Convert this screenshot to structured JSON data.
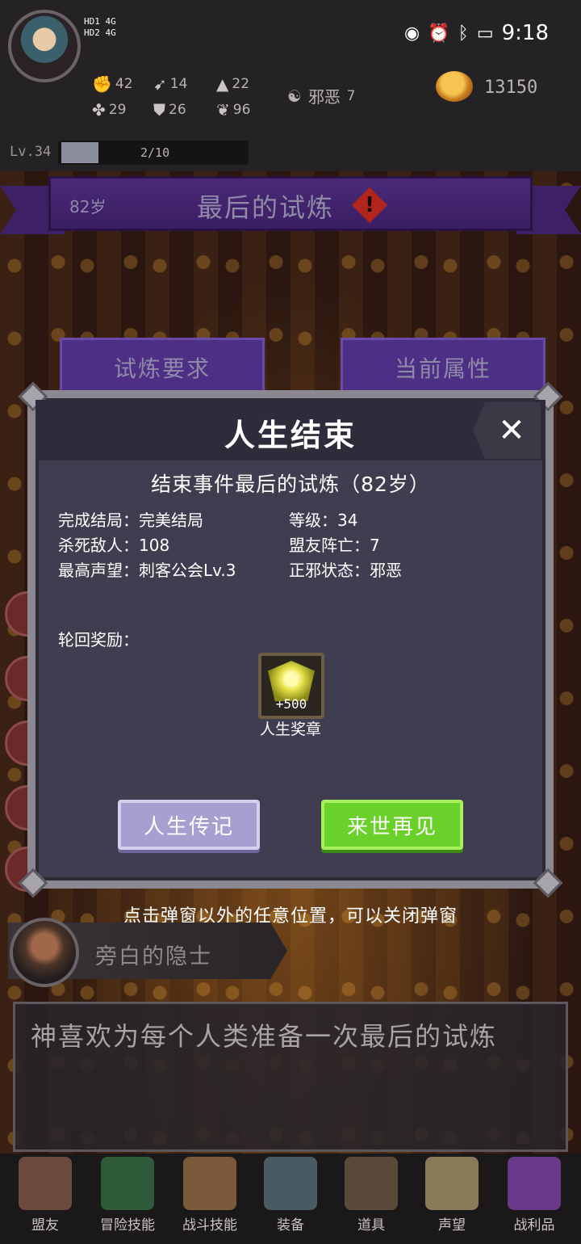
{
  "status_bar": {
    "net_top": "HD1  4G",
    "net_bottom": "HD2  4G",
    "icons": [
      "eye-icon",
      "alarm-icon",
      "bluetooth-icon",
      "battery-icon"
    ],
    "time": "9:18"
  },
  "player": {
    "stats": [
      {
        "icon": "fist-icon",
        "value": "42"
      },
      {
        "icon": "boot-icon",
        "value": "14"
      },
      {
        "icon": "wizard-hat-icon",
        "value": "22"
      },
      {
        "icon": "clover-icon",
        "value": "29"
      },
      {
        "icon": "armor-icon",
        "value": "26"
      },
      {
        "icon": "leaf-icon",
        "value": "96"
      }
    ],
    "alignment_label": "邪恶",
    "alignment_value": "7",
    "gold": "13150",
    "level": "Lv.34",
    "xp": "2/10",
    "xp_fraction": 0.2
  },
  "event": {
    "age": "82岁",
    "title": "最后的试炼",
    "warning": "!",
    "tab_left": "试炼要求",
    "tab_right": "当前属性"
  },
  "modal": {
    "title": "人生结束",
    "close": "✕",
    "subtitle": "结束事件最后的试炼（82岁）",
    "info": [
      "完成结局：完美结局",
      "等级：34",
      "杀死敌人：108",
      "盟友阵亡：7",
      "最高声望：刺客公会Lv.3",
      "正邪状态：邪恶"
    ],
    "rewards_label": "轮回奖励：",
    "reward_count": "+500",
    "reward_name": "人生奖章",
    "btn_bio": "人生传记",
    "btn_next": "来世再见"
  },
  "tip": "点击弹窗以外的任意位置，可以关闭弹窗",
  "narrator": {
    "name": "旁白的隐士",
    "text": "神喜欢为每个人类准备一次最后的试炼"
  },
  "nav": [
    {
      "label": "盟友",
      "color": "#6a4a3a"
    },
    {
      "label": "冒险技能",
      "color": "#2e5a3a"
    },
    {
      "label": "战斗技能",
      "color": "#7a5a3a"
    },
    {
      "label": "装备",
      "color": "#4a5a62"
    },
    {
      "label": "道具",
      "color": "#5a4a3a"
    },
    {
      "label": "声望",
      "color": "#8a7a5a"
    },
    {
      "label": "战利品",
      "color": "#6a3a8a"
    }
  ]
}
